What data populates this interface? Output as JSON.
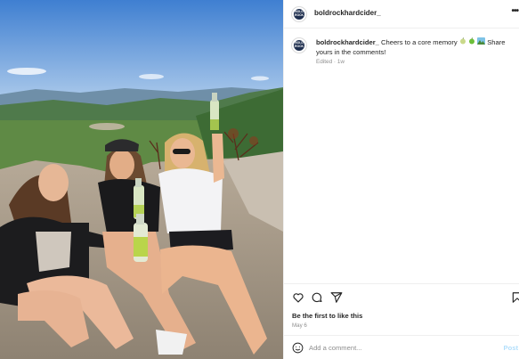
{
  "post": {
    "username": "boldrockhardcider_",
    "avatar_text": "BOLD ROCK",
    "more_icon": "more-horizontal-icon",
    "caption_text": "Cheers to a core memory",
    "caption_emojis": [
      "apple-icon",
      "apple-icon",
      "mountain-photo-icon"
    ],
    "caption_tail": "Share yours in the comments!",
    "edited_label": "Edited",
    "time_ago": "1w"
  },
  "actions": {
    "like_icon": "heart-icon",
    "comment_icon": "comment-icon",
    "share_icon": "send-icon",
    "save_icon": "bookmark-icon"
  },
  "likes_text": "Be the first to like this",
  "date_text": "May 6",
  "comment": {
    "placeholder": "Add a comment...",
    "post_label": "Post",
    "emoji_icon": "smiley-icon"
  },
  "colors": {
    "sky": "#6e9bd4",
    "accent_link": "#b2dffc",
    "secondary_text": "#8e8e8e",
    "border": "#efefef"
  }
}
